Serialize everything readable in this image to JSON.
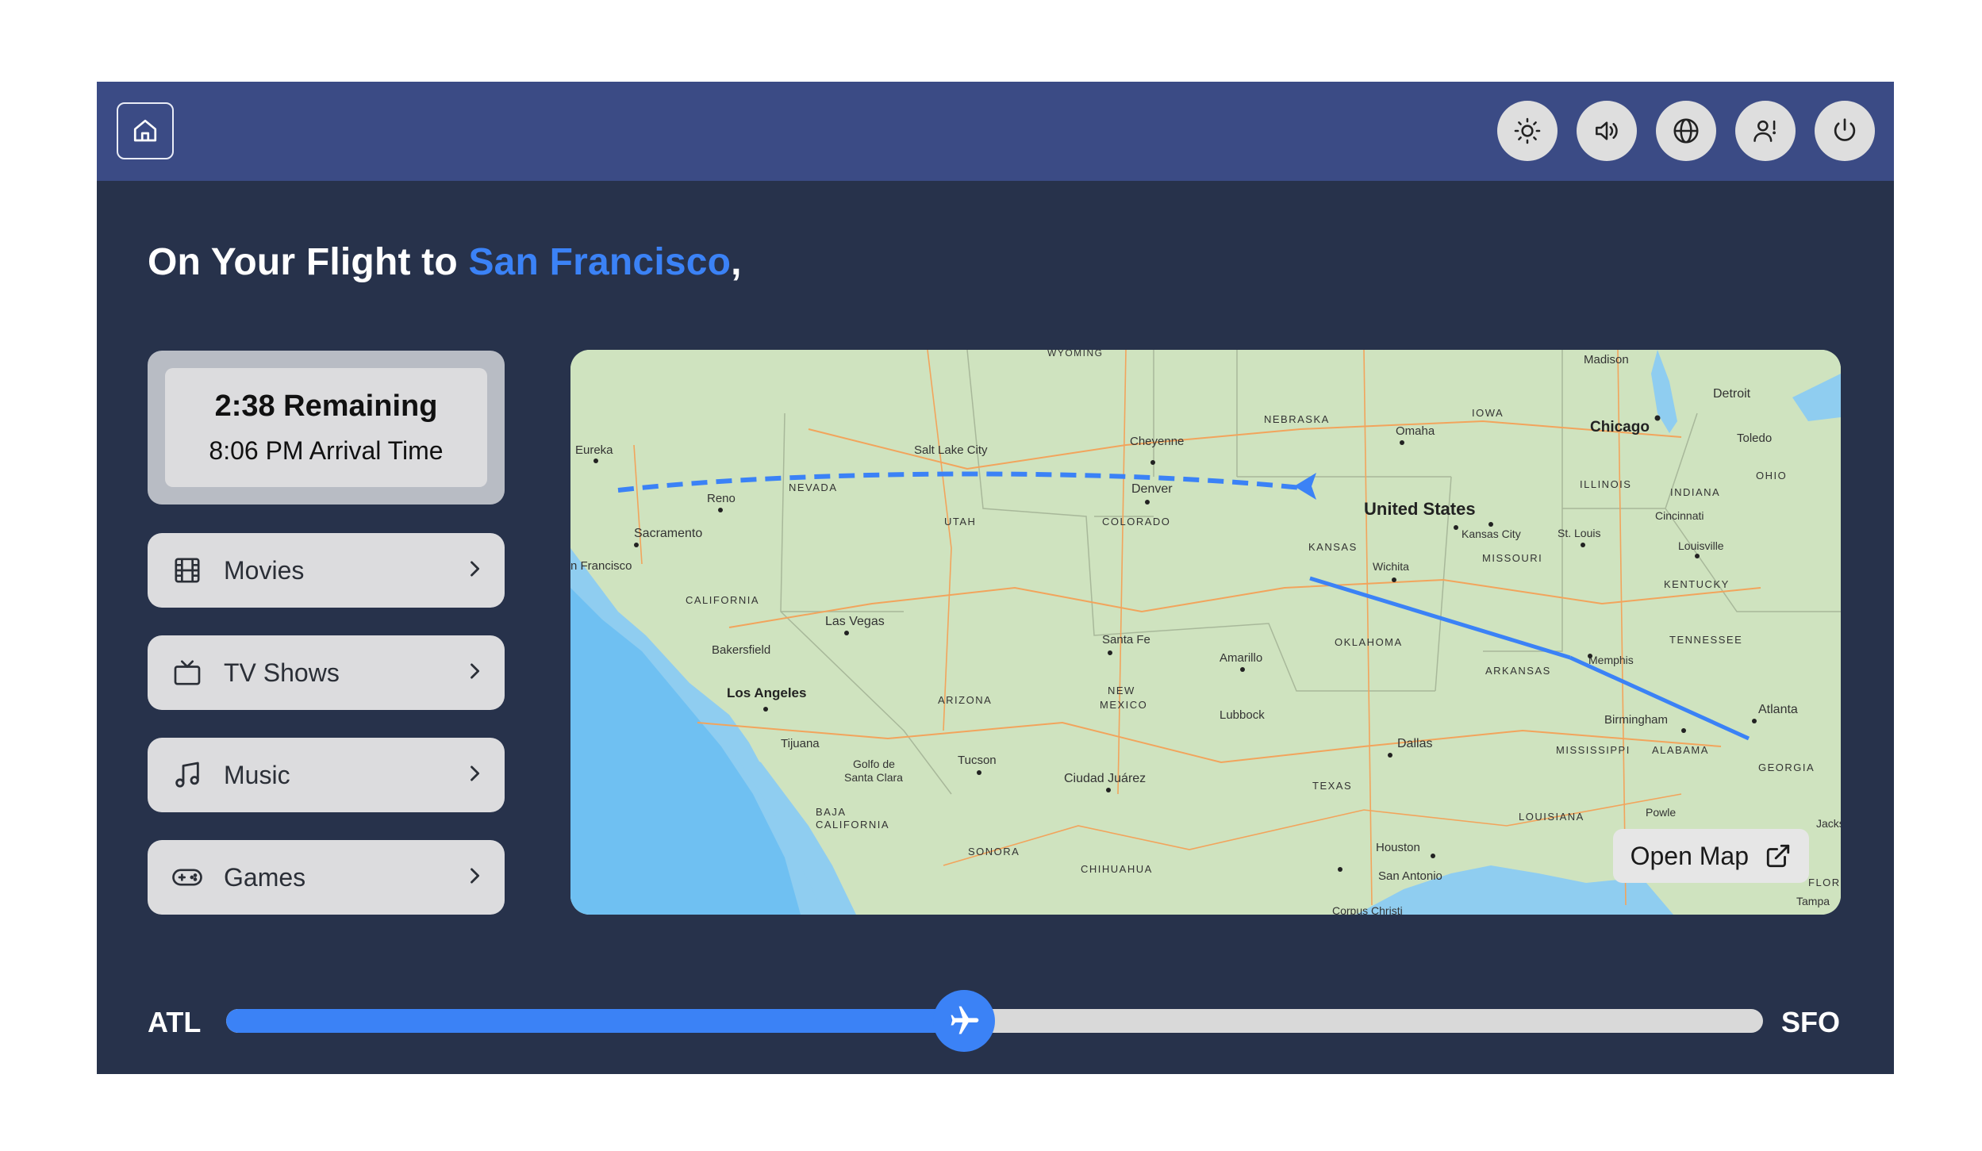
{
  "header": {
    "icons": [
      "home-icon",
      "brightness-icon",
      "volume-icon",
      "globe-icon",
      "call-attendant-icon",
      "power-icon"
    ]
  },
  "headline": {
    "prefix": "On Your Flight to ",
    "destination": "San Francisco",
    "suffix": ","
  },
  "flight_status": {
    "remaining": "2:38 Remaining",
    "arrival": "8:06 PM Arrival Time"
  },
  "menu": [
    {
      "label": "Movies",
      "icon": "film-icon"
    },
    {
      "label": "TV Shows",
      "icon": "tv-icon"
    },
    {
      "label": "Music",
      "icon": "music-note-icon"
    },
    {
      "label": "Games",
      "icon": "gamepad-icon"
    }
  ],
  "map": {
    "open_map_label": "Open Map",
    "labels": {
      "country": "United States",
      "cities": [
        "Madison",
        "Detroit",
        "Chicago",
        "Toledo",
        "Omaha",
        "Cheyenne",
        "Salt Lake City",
        "Eureka",
        "Reno",
        "Sacramento",
        "Denver",
        "Kansas City",
        "St. Louis",
        "Cincinnati",
        "Louisville",
        "Wichita",
        "San Francisco",
        "Las Vegas",
        "Bakersfield",
        "Los Angeles",
        "Tijuana",
        "Golfo de Santa Clara",
        "Tucson",
        "Ciudad Juárez",
        "Santa Fe",
        "Amarillo",
        "Lubbock",
        "Dallas",
        "Memphis",
        "Birmingham",
        "Atlanta",
        "Houston",
        "San Antonio",
        "Corpus Christi",
        "Tampa",
        "Jacksonville"
      ],
      "regions": [
        "WYOMING",
        "NEBRASKA",
        "IOWA",
        "ILLINOIS",
        "INDIANA",
        "OHIO",
        "NEVADA",
        "UTAH",
        "COLORADO",
        "KANSAS",
        "MISSOURI",
        "KENTUCKY",
        "CALIFORNIA",
        "OKLAHOMA",
        "ARKANSAS",
        "TENNESSEE",
        "ARIZONA",
        "NEW MEXICO",
        "MISSISSIPPI",
        "ALABAMA",
        "GEORGIA",
        "TEXAS",
        "LOUISIANA",
        "BAJA CALIFORNIA",
        "SONORA",
        "CHIHUAHUA",
        "FLORIDA"
      ]
    }
  },
  "progress": {
    "origin": "ATL",
    "destination": "SFO",
    "fraction_complete": 0.48
  },
  "colors": {
    "accent": "#3b82f6",
    "topbar": "#3b4b85",
    "background": "#27324b"
  }
}
